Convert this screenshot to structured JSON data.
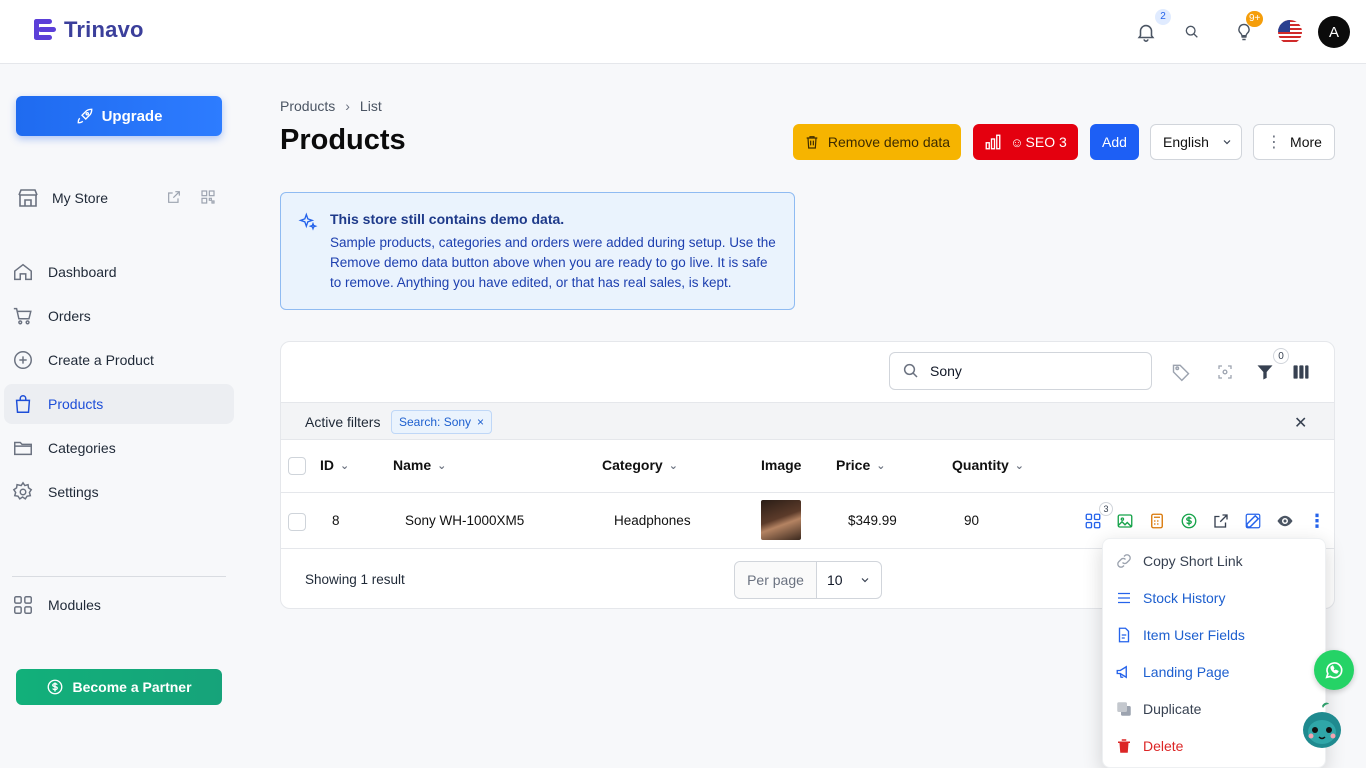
{
  "header": {
    "brand": "Trinavo",
    "notifications_count": "2",
    "ideas_count": "9+",
    "avatar_letter": "A"
  },
  "sidebar": {
    "upgrade_label": "Upgrade",
    "store_name": "My Store",
    "items": [
      {
        "label": "Dashboard",
        "icon": "home-icon"
      },
      {
        "label": "Orders",
        "icon": "cart-icon"
      },
      {
        "label": "Create a Product",
        "icon": "plus-circle-icon"
      },
      {
        "label": "Products",
        "icon": "bag-icon",
        "active": true
      },
      {
        "label": "Categories",
        "icon": "folder-icon"
      },
      {
        "label": "Settings",
        "icon": "gear-icon"
      }
    ],
    "modules_label": "Modules",
    "partner_label": "Become a Partner"
  },
  "page": {
    "breadcrumb": [
      "Products",
      "List"
    ],
    "title": "Products",
    "remove_demo_label": "Remove demo data",
    "seo_label": "SEO 3",
    "add_label": "Add",
    "language": "English",
    "more_label": "More"
  },
  "info": {
    "title": "This store still contains demo data.",
    "body": "Sample products, categories and orders were added during setup. Use the Remove demo data button above when you are ready to go live. It is safe to remove. Anything you have edited, or that has real sales, is kept."
  },
  "table": {
    "search_value": "Sony",
    "filter_count": "0",
    "active_filters_label": "Active filters",
    "filter_chip": "Search: Sony",
    "columns": [
      "ID",
      "Name",
      "Category",
      "Image",
      "Price",
      "Quantity"
    ],
    "rows": [
      {
        "id": "8",
        "name": "Sony WH-1000XM5",
        "category": "Headphones",
        "price": "$349.99",
        "quantity": "90",
        "variants_count": "3"
      }
    ],
    "showing": "Showing 1 result",
    "per_page_label": "Per page",
    "per_page_value": "10"
  },
  "menu": {
    "items": [
      {
        "label": "Copy Short Link",
        "icon": "link-icon",
        "color": "#374151"
      },
      {
        "label": "Stock History",
        "icon": "list-icon",
        "color": "#1d5fcf"
      },
      {
        "label": "Item User Fields",
        "icon": "document-icon",
        "color": "#1d5fcf"
      },
      {
        "label": "Landing Page",
        "icon": "megaphone-icon",
        "color": "#1d5fcf"
      },
      {
        "label": "Duplicate",
        "icon": "copy-icon",
        "color": "#374151"
      },
      {
        "label": "Delete",
        "icon": "trash-icon",
        "color": "#dc2626"
      }
    ]
  },
  "colors": {
    "accent": "#1d5ff5",
    "demo": "#f6b400",
    "seo": "#e4000f",
    "partner": "#12b07a"
  }
}
